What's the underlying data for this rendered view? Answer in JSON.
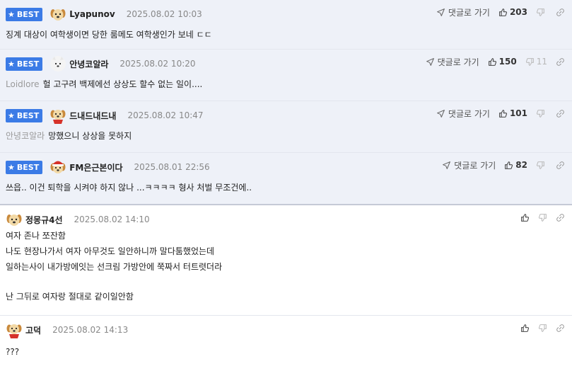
{
  "comments": [
    {
      "best": true,
      "badge": "BEST",
      "nick": "Lyapunov",
      "date": "2025.08.02 10:03",
      "reply_label": "댓글로 가기",
      "upvotes": "203",
      "downvotes": "",
      "mention": "",
      "lines": [
        "징계 대상이 여학생이면 당한 룸메도 여학생인가 보네 ㄷㄷ"
      ],
      "avatar": "dog-avatar"
    },
    {
      "best": true,
      "badge": "BEST",
      "nick": "안녕코알라",
      "date": "2025.08.02 10:20",
      "reply_label": "댓글로 가기",
      "upvotes": "150",
      "downvotes": "11",
      "mention": "Loidlore",
      "lines": [
        "헐 고구려 백제에선 상상도 할수 없는 일이...."
      ],
      "avatar": "white-dog-avatar"
    },
    {
      "best": true,
      "badge": "BEST",
      "nick": "드내드내드내",
      "date": "2025.08.02 10:47",
      "reply_label": "댓글로 가기",
      "upvotes": "101",
      "downvotes": "",
      "mention": "안녕코알라",
      "lines": [
        "망했으니 상상을 못하지"
      ],
      "avatar": "dog-red-avatar"
    },
    {
      "best": true,
      "badge": "BEST",
      "nick": "FM은근본이다",
      "date": "2025.08.01 22:56",
      "reply_label": "댓글로 가기",
      "upvotes": "82",
      "downvotes": "",
      "mention": "",
      "lines": [
        "쓰읍.. 이건 퇴학을 시켜야 하지 않나 ...ㅋㅋㅋㅋ 형사 처벌 무조건에.."
      ],
      "avatar": "dog-santa-avatar"
    },
    {
      "best": false,
      "badge": "",
      "nick": "정몽규4선",
      "date": "2025.08.02 14:10",
      "reply_label": "",
      "upvotes": "",
      "downvotes": "",
      "mention": "",
      "lines": [
        "여자 존나 쪼잔함",
        "나도 현장나가서 여자 아무것도 일안하니까 말다툼했었는데",
        "일하는사이 내가방에잇는 선크림 가방안에 쭉짜서 터트렷더라",
        "",
        "난 그뒤로 여자랑 절대로 같이일안함"
      ],
      "avatar": "dog-avatar"
    },
    {
      "best": false,
      "badge": "",
      "nick": "고덕",
      "date": "2025.08.02 14:13",
      "reply_label": "",
      "upvotes": "",
      "downvotes": "",
      "mention": "",
      "lines": [
        "???"
      ],
      "avatar": "dog-red-avatar"
    }
  ],
  "colors": {
    "best_bg": "#eef1f8",
    "badge": "#3b7be6",
    "mention": "#9a9a9a"
  },
  "icons": {
    "reply": "paper-plane-icon",
    "upvote": "thumb-up-icon",
    "downvote": "thumb-down-icon",
    "link": "link-icon",
    "badge": "star-icon"
  }
}
